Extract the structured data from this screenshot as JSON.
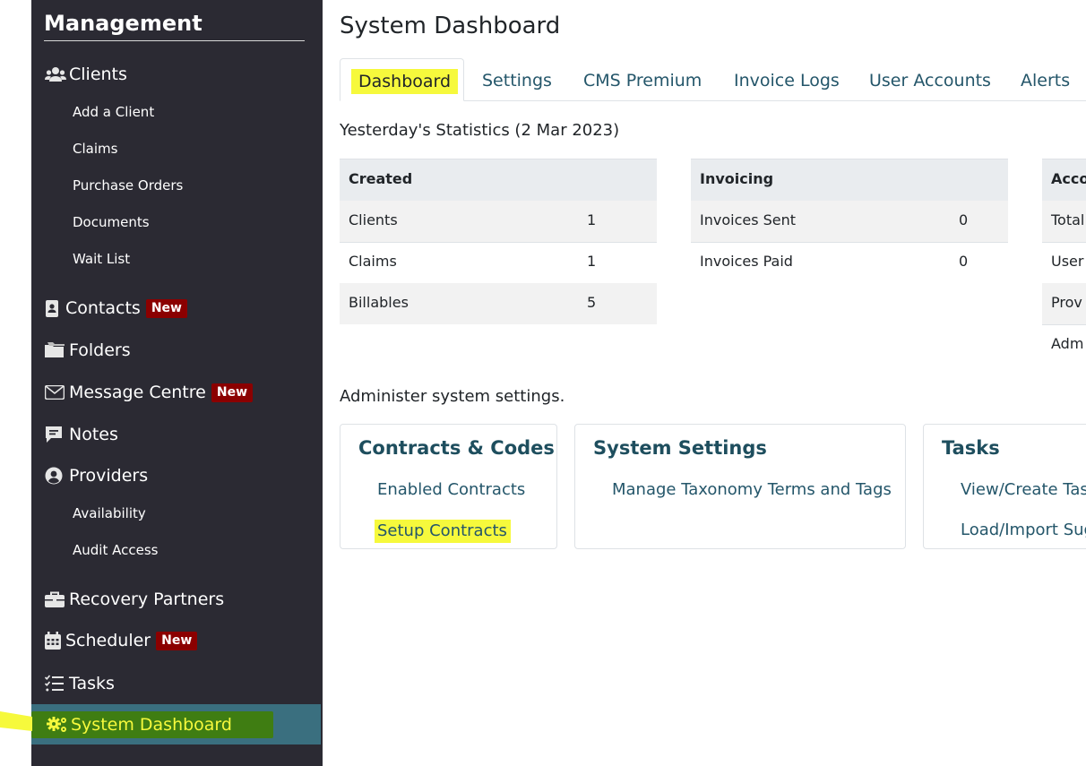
{
  "sidebar": {
    "title": "Management",
    "clients": {
      "label": "Clients",
      "sub": [
        "Add a Client",
        "Claims",
        "Purchase Orders",
        "Documents",
        "Wait List"
      ]
    },
    "contacts": {
      "label": "Contacts",
      "badge": "New"
    },
    "folders": {
      "label": "Folders"
    },
    "message_centre": {
      "label": "Message Centre",
      "badge": "New"
    },
    "notes": {
      "label": "Notes"
    },
    "providers": {
      "label": "Providers",
      "sub": [
        "Availability",
        "Audit Access"
      ]
    },
    "recovery_partners": {
      "label": "Recovery Partners"
    },
    "scheduler": {
      "label": "Scheduler",
      "badge": "New"
    },
    "tasks": {
      "label": "Tasks"
    },
    "system_dashboard": {
      "label": "System Dashboard"
    }
  },
  "main": {
    "title": "System Dashboard",
    "tabs": [
      "Dashboard",
      "Settings",
      "CMS Premium",
      "Invoice Logs",
      "User Accounts",
      "Alerts"
    ],
    "stats_caption": "Yesterday's Statistics (2 Mar 2023)",
    "tables": {
      "created": {
        "header": "Created",
        "rows": [
          {
            "label": "Clients",
            "value": "1"
          },
          {
            "label": "Claims",
            "value": "1"
          },
          {
            "label": "Billables",
            "value": "5"
          }
        ]
      },
      "invoicing": {
        "header": "Invoicing",
        "rows": [
          {
            "label": "Invoices Sent",
            "value": "0"
          },
          {
            "label": "Invoices Paid",
            "value": "0"
          }
        ]
      },
      "accounts": {
        "header": "Acco",
        "rows": [
          {
            "label": "Total"
          },
          {
            "label": "User"
          },
          {
            "label": "Prov"
          },
          {
            "label": "Adm"
          }
        ]
      }
    },
    "admin_caption": "Administer system settings.",
    "cards": {
      "contracts": {
        "title": "Contracts & Codes",
        "links": [
          "Enabled Contracts",
          "Setup Contracts"
        ]
      },
      "system_settings": {
        "title": "System Settings",
        "links": [
          "Manage Taxonomy Terms and Tags"
        ]
      },
      "tasks": {
        "title": "Tasks",
        "links": [
          "View/Create Tas",
          "Load/Import Sug"
        ]
      }
    }
  },
  "colors": {
    "sidebar_bg": "#2b2a33",
    "active_item": "#3a6f7f",
    "highlight": "#f6f93c",
    "badge": "#8b0000",
    "link": "#24566a"
  },
  "icons": [
    "users-icon",
    "contact-card-icon",
    "folder-icon",
    "envelope-icon",
    "note-icon",
    "user-circle-icon",
    "briefcase-icon",
    "calendar-icon",
    "checklist-icon",
    "gears-icon"
  ]
}
